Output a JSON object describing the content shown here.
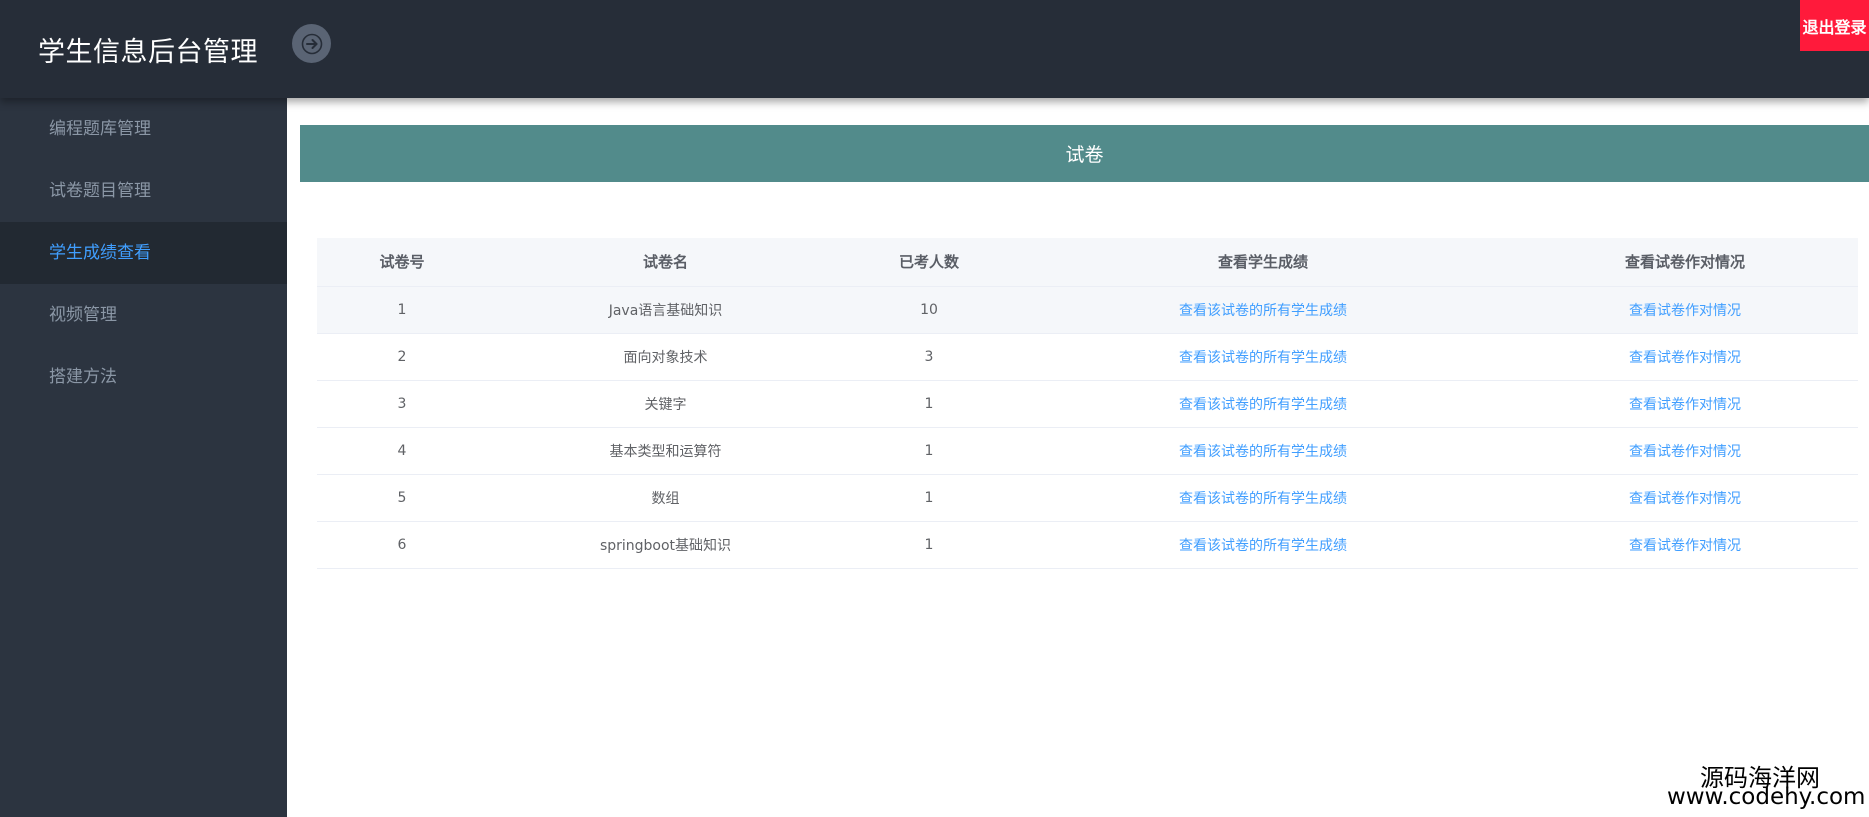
{
  "header": {
    "title": "学生信息后台管理",
    "toggle_icon": "arrow-right-icon",
    "logout_label": "退出登录"
  },
  "sidebar": {
    "items": [
      {
        "label": "编程题库管理",
        "active": false
      },
      {
        "label": "试卷题目管理",
        "active": false
      },
      {
        "label": "学生成绩查看",
        "active": true
      },
      {
        "label": "视频管理",
        "active": false
      },
      {
        "label": "搭建方法",
        "active": false
      }
    ]
  },
  "main": {
    "banner_title": "试卷",
    "table": {
      "columns": [
        "试卷号",
        "试卷名",
        "已考人数",
        "查看学生成绩",
        "查看试卷作对情况"
      ],
      "rows": [
        {
          "id": "1",
          "name": "Java语言基础知识",
          "count": "10",
          "scores_link": "查看该试卷的所有学生成绩",
          "correct_link": "查看试卷作对情况"
        },
        {
          "id": "2",
          "name": "面向对象技术",
          "count": "3",
          "scores_link": "查看该试卷的所有学生成绩",
          "correct_link": "查看试卷作对情况"
        },
        {
          "id": "3",
          "name": "关键字",
          "count": "1",
          "scores_link": "查看该试卷的所有学生成绩",
          "correct_link": "查看试卷作对情况"
        },
        {
          "id": "4",
          "name": "基本类型和运算符",
          "count": "1",
          "scores_link": "查看该试卷的所有学生成绩",
          "correct_link": "查看试卷作对情况"
        },
        {
          "id": "5",
          "name": "数组",
          "count": "1",
          "scores_link": "查看该试卷的所有学生成绩",
          "correct_link": "查看试卷作对情况"
        },
        {
          "id": "6",
          "name": "springboot基础知识",
          "count": "1",
          "scores_link": "查看该试卷的所有学生成绩",
          "correct_link": "查看试卷作对情况"
        }
      ]
    }
  },
  "watermark": {
    "name": "源码海洋网",
    "url": "www.codehy.com"
  },
  "colors": {
    "header_bg": "#262d38",
    "sidebar_bg": "#2c3440",
    "active_text": "#409eff",
    "banner_bg": "#528b8b",
    "logout_bg": "#ff1a3b"
  }
}
